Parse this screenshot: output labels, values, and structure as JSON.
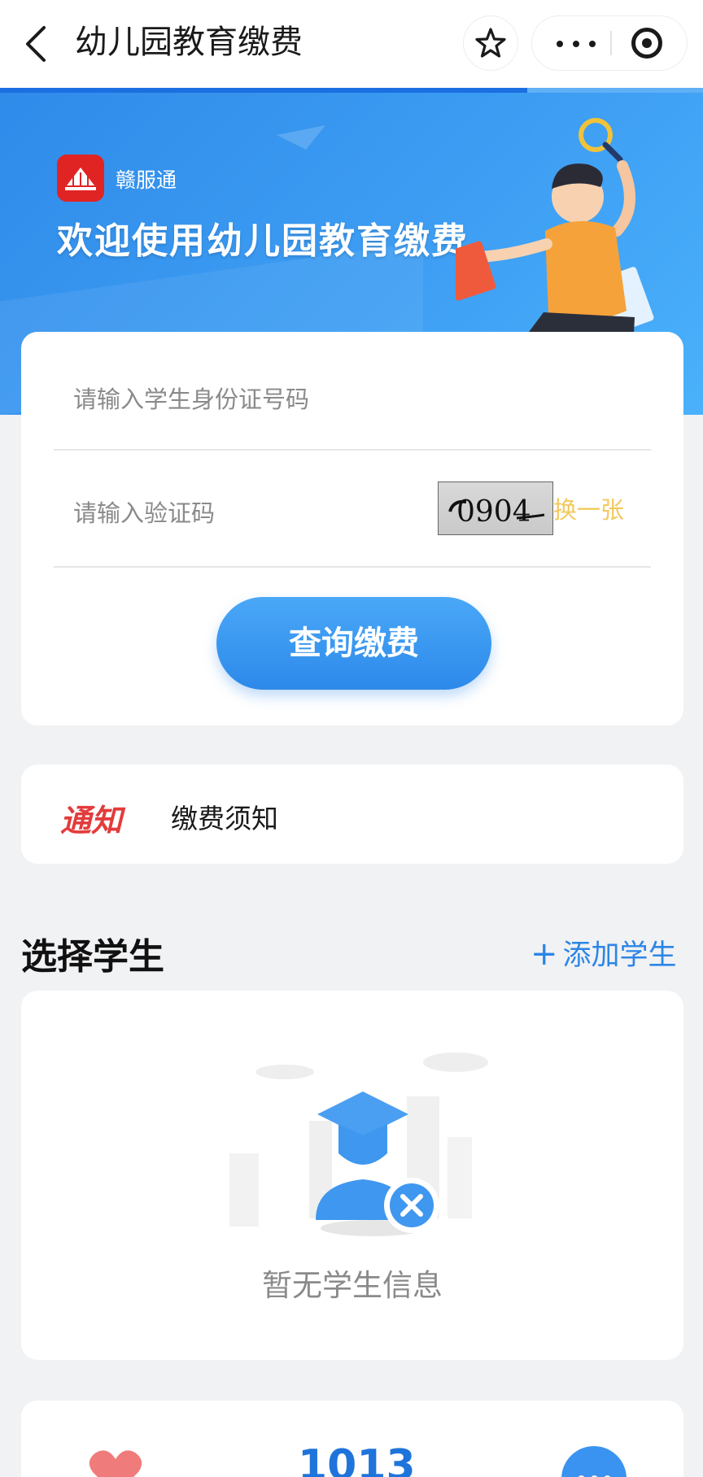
{
  "header": {
    "title": "幼儿园教育缴费",
    "back_icon": "chevron-left-icon",
    "favorite_icon": "star-icon",
    "more_icon": "more-horizontal-icon",
    "close_icon": "target-circle-icon"
  },
  "banner": {
    "brand": "赣服通",
    "welcome": "欢迎使用幼儿园教育缴费"
  },
  "form": {
    "id_placeholder": "请输入学生身份证号码",
    "code_placeholder": "请输入验证码",
    "captcha_text": "0904",
    "refresh_label": "换一张",
    "query_label": "查询缴费"
  },
  "notice": {
    "tag": "通知",
    "text": "缴费须知"
  },
  "students": {
    "title": "选择学生",
    "add_label": "添加学生",
    "empty_text": "暂无学生信息"
  },
  "bottom": {
    "count": "1013"
  },
  "colors": {
    "accent": "#2c86e6",
    "banner": "#3d9df3",
    "notice_red": "#e33b3b",
    "refresh_yellow": "#f3c95d"
  }
}
